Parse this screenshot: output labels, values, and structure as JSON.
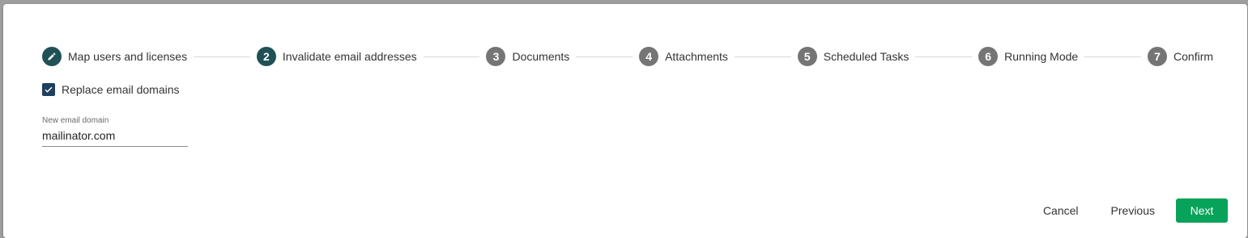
{
  "stepper": {
    "steps": [
      {
        "number": "",
        "label": "Map users and licenses",
        "state": "done",
        "icon": "pencil-icon"
      },
      {
        "number": "2",
        "label": "Invalidate email addresses",
        "state": "active"
      },
      {
        "number": "3",
        "label": "Documents",
        "state": "pending"
      },
      {
        "number": "4",
        "label": "Attachments",
        "state": "pending"
      },
      {
        "number": "5",
        "label": "Scheduled Tasks",
        "state": "pending"
      },
      {
        "number": "6",
        "label": "Running Mode",
        "state": "pending"
      },
      {
        "number": "7",
        "label": "Confirm",
        "state": "pending"
      }
    ]
  },
  "form": {
    "replace_domains": {
      "label": "Replace email domains",
      "checked": true
    },
    "new_domain": {
      "label": "New email domain",
      "value": "mailinator.com"
    }
  },
  "actions": {
    "cancel": "Cancel",
    "previous": "Previous",
    "next": "Next"
  },
  "colors": {
    "step_done": "#1f5156",
    "step_pending": "#757575",
    "checkbox": "#1f3f5e",
    "next_button": "#07a35a"
  }
}
